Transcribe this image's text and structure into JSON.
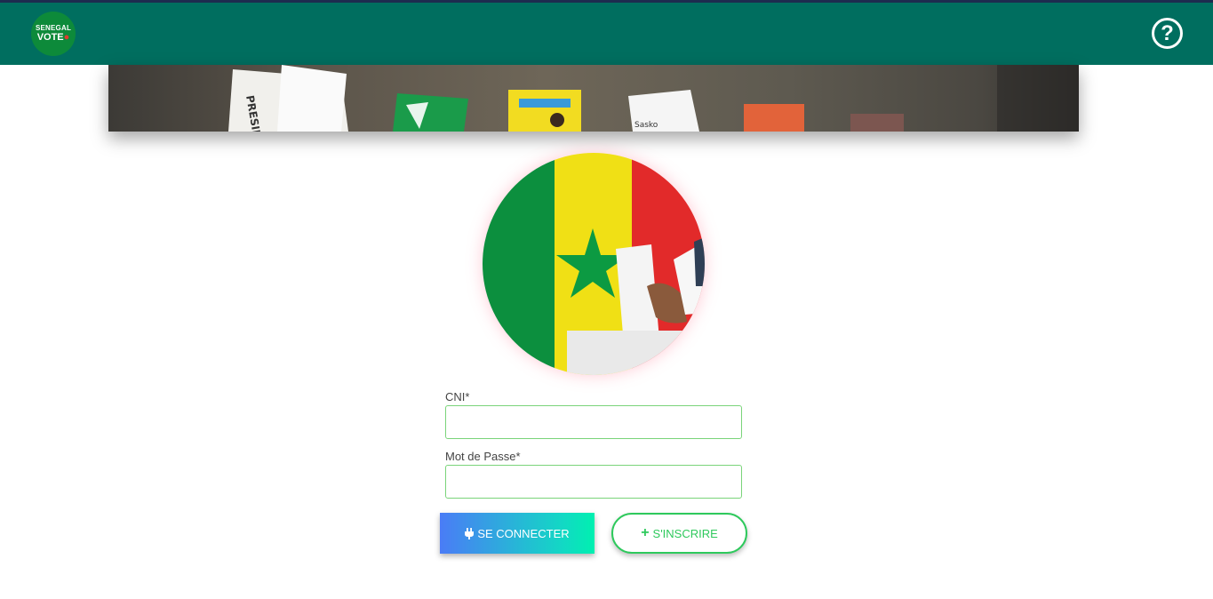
{
  "header": {
    "logo_line1": "SENEGAL",
    "logo_line2": "VOTE",
    "help_icon": "question-circle-icon"
  },
  "banner": {
    "description_icon": "ballot-papers-banner"
  },
  "hero": {
    "image": "senegal-flag-ballot-circle"
  },
  "form": {
    "cni_label": "CNI*",
    "cni_value": "",
    "password_label": "Mot de Passe*",
    "password_value": ""
  },
  "buttons": {
    "login_icon": "plug-icon",
    "login_label": "SE CONNECTER",
    "signup_icon": "plus-icon",
    "signup_label": "S'INSCRIRE"
  },
  "colors": {
    "navbar": "#006e5f",
    "field_border": "#7ad47a",
    "signup": "#2ec95c",
    "login_gradient_start": "#4a7cf6",
    "login_gradient_end": "#00f0b0"
  }
}
